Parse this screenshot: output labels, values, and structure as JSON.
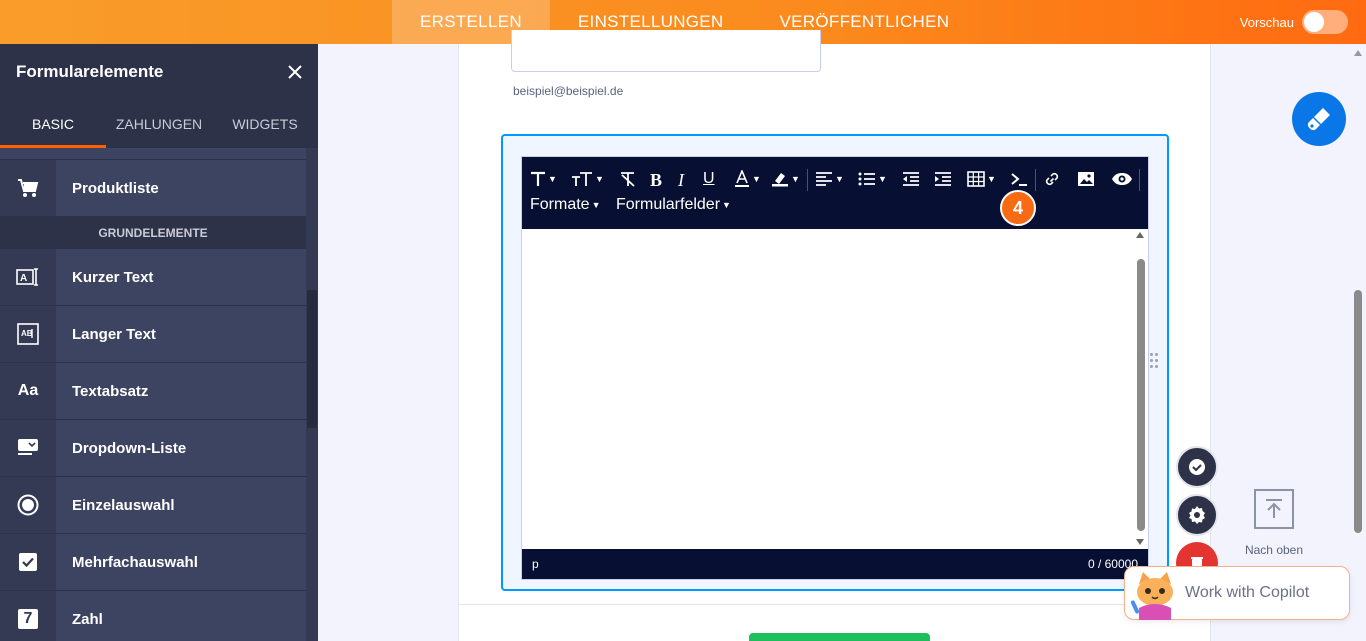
{
  "topbar": {
    "tabs": [
      {
        "label": "ERSTELLEN",
        "active": true
      },
      {
        "label": "EINSTELLUNGEN",
        "active": false
      },
      {
        "label": "VERÖFFENTLICHEN",
        "active": false
      }
    ],
    "preview_label": "Vorschau"
  },
  "sidebar": {
    "title": "Formularelemente",
    "tabs": [
      {
        "label": "BASIC",
        "active": true
      },
      {
        "label": "ZAHLUNGEN",
        "active": false
      },
      {
        "label": "WIDGETS",
        "active": false
      }
    ],
    "top_item": {
      "label": "Produktliste",
      "icon": "cart-icon"
    },
    "section_label": "GRUNDELEMENTE",
    "items": [
      {
        "label": "Kurzer Text",
        "icon": "short-text-icon"
      },
      {
        "label": "Langer Text",
        "icon": "long-text-icon"
      },
      {
        "label": "Textabsatz",
        "icon": "paragraph-icon",
        "glyph": "Aa"
      },
      {
        "label": "Dropdown-Liste",
        "icon": "dropdown-icon"
      },
      {
        "label": "Einzelauswahl",
        "icon": "radio-icon"
      },
      {
        "label": "Mehrfachauswahl",
        "icon": "checkbox-icon"
      },
      {
        "label": "Zahl",
        "icon": "number-icon",
        "glyph": "7"
      }
    ]
  },
  "form": {
    "email_sublabel": "beispiel@beispiel.de",
    "editor": {
      "toolbar": {
        "formats_label": "Formate",
        "form_fields_label": "Formularfelder",
        "step_badge": "4"
      },
      "status_path": "p",
      "char_count": "0 / 60000"
    }
  },
  "floating": {
    "back_to_top_label": "Nach oben",
    "copilot_label": "Work with Copilot"
  },
  "colors": {
    "topbar": "#fb8a1d",
    "sidebar": "#3d4461",
    "accent": "#ff6100",
    "toolbar": "#070f33",
    "selection": "#0099ff"
  }
}
